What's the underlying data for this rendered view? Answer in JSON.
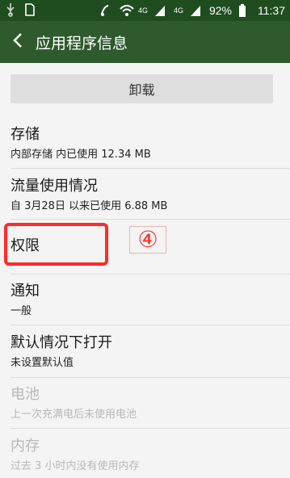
{
  "status_bar": {
    "battery_percent": "92%",
    "time": "11:37",
    "network_label_1": "4G",
    "network_label_2": "4G",
    "icons": [
      "usb-icon",
      "sim-icon",
      "mute-icon",
      "wifi-icon",
      "signal-icon",
      "signal-icon",
      "battery-icon"
    ]
  },
  "app_bar": {
    "title": "应用程序信息",
    "back_icon": "back-arrow-icon",
    "background": "#2e5a2e"
  },
  "uninstall_button": {
    "label": "卸载"
  },
  "items": [
    {
      "title": "存储",
      "subtitle": "内部存储 内已使用 12.34 MB",
      "enabled": true
    },
    {
      "title": "流量使用情况",
      "subtitle": "自 3月28日 以来已使用 6.88 MB",
      "enabled": true
    },
    {
      "title": "权限",
      "subtitle": "",
      "enabled": true
    },
    {
      "title": "通知",
      "subtitle": "一般",
      "enabled": true
    },
    {
      "title": "默认情况下打开",
      "subtitle": "未设置默认值",
      "enabled": true
    },
    {
      "title": "电池",
      "subtitle": "上一次充满电后未使用电池",
      "enabled": false
    },
    {
      "title": "内存",
      "subtitle": "过去 3 小时内没有使用内存",
      "enabled": false
    }
  ],
  "annotation": {
    "marker": "④",
    "color": "#ff2b2b"
  }
}
